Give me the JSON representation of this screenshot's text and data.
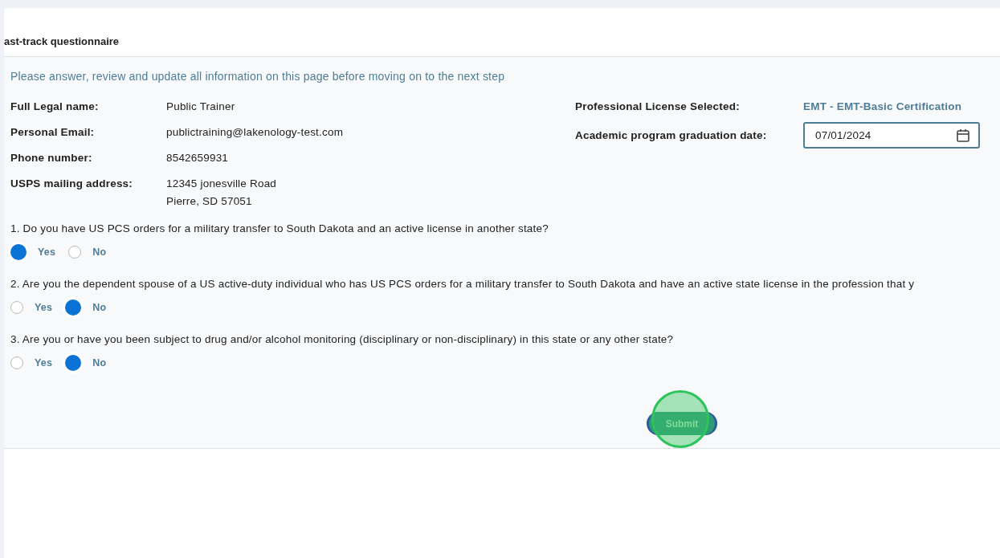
{
  "header": {
    "title": "ast-track questionnaire"
  },
  "intro": "Please answer, review and update all information on this page before moving on to the next step",
  "details": [
    {
      "label": "Full Legal name:",
      "lines": [
        "Public Trainer"
      ]
    },
    {
      "label": "Personal Email:",
      "lines": [
        "publictraining@lakenology-test.com"
      ]
    },
    {
      "label": "Phone number:",
      "lines": [
        "8542659931"
      ]
    },
    {
      "label": "USPS mailing address:",
      "lines": [
        "12345 jonesville Road",
        "Pierre, SD 57051"
      ]
    }
  ],
  "license": {
    "label": "Professional License Selected:",
    "value": "EMT - EMT-Basic Certification"
  },
  "graduation": {
    "label": "Academic program graduation date:",
    "value": "07/01/2024"
  },
  "questions": [
    {
      "text": "1. Do you have US PCS orders for a military transfer to South Dakota and an active license in another state?",
      "options": [
        {
          "label": "Yes",
          "selected": true
        },
        {
          "label": "No",
          "selected": false
        }
      ]
    },
    {
      "text": "2. Are you the dependent spouse of a US active-duty individual who has US PCS orders for a military transfer to South Dakota and have an active state license in the profession that y",
      "options": [
        {
          "label": "Yes",
          "selected": false
        },
        {
          "label": "No",
          "selected": true
        }
      ]
    },
    {
      "text": "3. Are you or have you been subject to drug and/or alcohol monitoring (disciplinary or non-disciplinary) in this state or any other state?",
      "options": [
        {
          "label": "Yes",
          "selected": false
        },
        {
          "label": "No",
          "selected": true
        }
      ]
    }
  ],
  "submit": {
    "label": "Submit"
  }
}
